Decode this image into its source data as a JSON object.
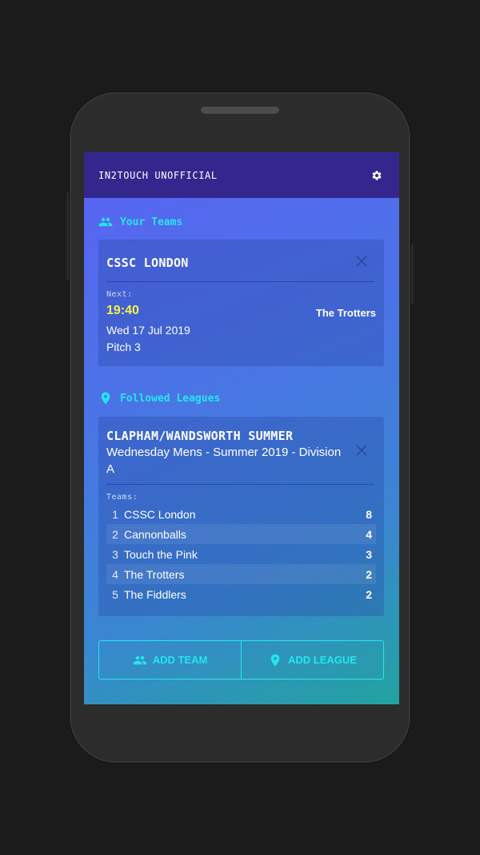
{
  "app": {
    "title": "IN2TOUCH UNOFFICIAL"
  },
  "icons": {
    "settings": "gear-icon",
    "teams": "people-icon",
    "leagues": "location-pin-icon",
    "close": "close-icon"
  },
  "colors": {
    "accent": "#25e6f0",
    "appbar": "#33278e",
    "time_highlight": "#f3f34a"
  },
  "your_teams": {
    "heading": "Your Teams",
    "team": {
      "name": "CSSC LONDON",
      "next_label": "Next:",
      "time": "19:40",
      "date": "Wed 17 Jul 2019",
      "pitch": "Pitch 3",
      "opponent": "The Trotters"
    }
  },
  "followed_leagues": {
    "heading": "Followed Leagues",
    "league": {
      "name": "CLAPHAM/WANDSWORTH SUMMER",
      "subtitle": "Wednesday Mens - Summer 2019 - Division A",
      "teams_label": "Teams:",
      "standings": [
        {
          "pos": "1",
          "name": "CSSC London",
          "points": "8"
        },
        {
          "pos": "2",
          "name": "Cannonballs",
          "points": "4"
        },
        {
          "pos": "3",
          "name": "Touch the Pink",
          "points": "3"
        },
        {
          "pos": "4",
          "name": "The Trotters",
          "points": "2"
        },
        {
          "pos": "5",
          "name": "The Fiddlers",
          "points": "2"
        }
      ]
    }
  },
  "actions": {
    "add_team": "ADD TEAM",
    "add_league": "ADD LEAGUE"
  }
}
